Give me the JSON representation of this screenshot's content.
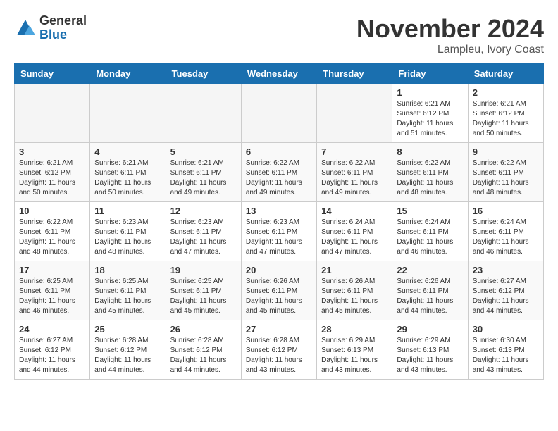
{
  "logo": {
    "general": "General",
    "blue": "Blue"
  },
  "title": "November 2024",
  "location": "Lampleu, Ivory Coast",
  "days_of_week": [
    "Sunday",
    "Monday",
    "Tuesday",
    "Wednesday",
    "Thursday",
    "Friday",
    "Saturday"
  ],
  "weeks": [
    [
      {
        "day": "",
        "info": ""
      },
      {
        "day": "",
        "info": ""
      },
      {
        "day": "",
        "info": ""
      },
      {
        "day": "",
        "info": ""
      },
      {
        "day": "",
        "info": ""
      },
      {
        "day": "1",
        "info": "Sunrise: 6:21 AM\nSunset: 6:12 PM\nDaylight: 11 hours and 51 minutes."
      },
      {
        "day": "2",
        "info": "Sunrise: 6:21 AM\nSunset: 6:12 PM\nDaylight: 11 hours and 50 minutes."
      }
    ],
    [
      {
        "day": "3",
        "info": "Sunrise: 6:21 AM\nSunset: 6:12 PM\nDaylight: 11 hours and 50 minutes."
      },
      {
        "day": "4",
        "info": "Sunrise: 6:21 AM\nSunset: 6:11 PM\nDaylight: 11 hours and 50 minutes."
      },
      {
        "day": "5",
        "info": "Sunrise: 6:21 AM\nSunset: 6:11 PM\nDaylight: 11 hours and 49 minutes."
      },
      {
        "day": "6",
        "info": "Sunrise: 6:22 AM\nSunset: 6:11 PM\nDaylight: 11 hours and 49 minutes."
      },
      {
        "day": "7",
        "info": "Sunrise: 6:22 AM\nSunset: 6:11 PM\nDaylight: 11 hours and 49 minutes."
      },
      {
        "day": "8",
        "info": "Sunrise: 6:22 AM\nSunset: 6:11 PM\nDaylight: 11 hours and 48 minutes."
      },
      {
        "day": "9",
        "info": "Sunrise: 6:22 AM\nSunset: 6:11 PM\nDaylight: 11 hours and 48 minutes."
      }
    ],
    [
      {
        "day": "10",
        "info": "Sunrise: 6:22 AM\nSunset: 6:11 PM\nDaylight: 11 hours and 48 minutes."
      },
      {
        "day": "11",
        "info": "Sunrise: 6:23 AM\nSunset: 6:11 PM\nDaylight: 11 hours and 48 minutes."
      },
      {
        "day": "12",
        "info": "Sunrise: 6:23 AM\nSunset: 6:11 PM\nDaylight: 11 hours and 47 minutes."
      },
      {
        "day": "13",
        "info": "Sunrise: 6:23 AM\nSunset: 6:11 PM\nDaylight: 11 hours and 47 minutes."
      },
      {
        "day": "14",
        "info": "Sunrise: 6:24 AM\nSunset: 6:11 PM\nDaylight: 11 hours and 47 minutes."
      },
      {
        "day": "15",
        "info": "Sunrise: 6:24 AM\nSunset: 6:11 PM\nDaylight: 11 hours and 46 minutes."
      },
      {
        "day": "16",
        "info": "Sunrise: 6:24 AM\nSunset: 6:11 PM\nDaylight: 11 hours and 46 minutes."
      }
    ],
    [
      {
        "day": "17",
        "info": "Sunrise: 6:25 AM\nSunset: 6:11 PM\nDaylight: 11 hours and 46 minutes."
      },
      {
        "day": "18",
        "info": "Sunrise: 6:25 AM\nSunset: 6:11 PM\nDaylight: 11 hours and 45 minutes."
      },
      {
        "day": "19",
        "info": "Sunrise: 6:25 AM\nSunset: 6:11 PM\nDaylight: 11 hours and 45 minutes."
      },
      {
        "day": "20",
        "info": "Sunrise: 6:26 AM\nSunset: 6:11 PM\nDaylight: 11 hours and 45 minutes."
      },
      {
        "day": "21",
        "info": "Sunrise: 6:26 AM\nSunset: 6:11 PM\nDaylight: 11 hours and 45 minutes."
      },
      {
        "day": "22",
        "info": "Sunrise: 6:26 AM\nSunset: 6:11 PM\nDaylight: 11 hours and 44 minutes."
      },
      {
        "day": "23",
        "info": "Sunrise: 6:27 AM\nSunset: 6:12 PM\nDaylight: 11 hours and 44 minutes."
      }
    ],
    [
      {
        "day": "24",
        "info": "Sunrise: 6:27 AM\nSunset: 6:12 PM\nDaylight: 11 hours and 44 minutes."
      },
      {
        "day": "25",
        "info": "Sunrise: 6:28 AM\nSunset: 6:12 PM\nDaylight: 11 hours and 44 minutes."
      },
      {
        "day": "26",
        "info": "Sunrise: 6:28 AM\nSunset: 6:12 PM\nDaylight: 11 hours and 44 minutes."
      },
      {
        "day": "27",
        "info": "Sunrise: 6:28 AM\nSunset: 6:12 PM\nDaylight: 11 hours and 43 minutes."
      },
      {
        "day": "28",
        "info": "Sunrise: 6:29 AM\nSunset: 6:13 PM\nDaylight: 11 hours and 43 minutes."
      },
      {
        "day": "29",
        "info": "Sunrise: 6:29 AM\nSunset: 6:13 PM\nDaylight: 11 hours and 43 minutes."
      },
      {
        "day": "30",
        "info": "Sunrise: 6:30 AM\nSunset: 6:13 PM\nDaylight: 11 hours and 43 minutes."
      }
    ]
  ]
}
